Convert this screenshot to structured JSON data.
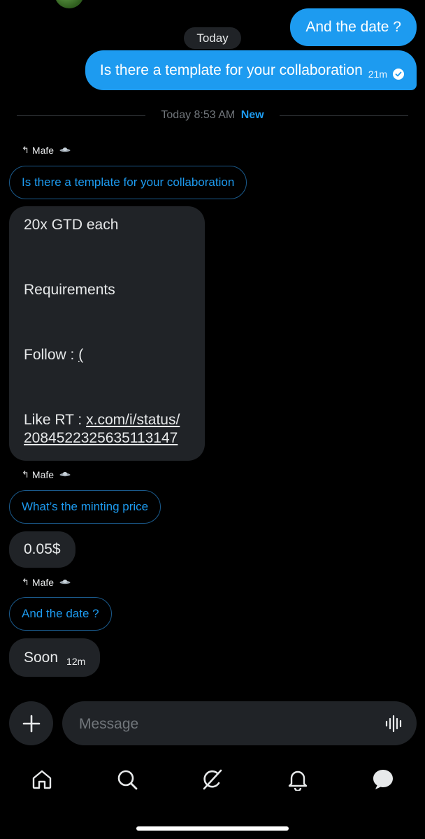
{
  "top_messages": {
    "out_1": "And the date ?",
    "date_pill": "Today",
    "out_2": "Is there a template for your collaboration",
    "out_2_time": "21m"
  },
  "divider": {
    "time": "Today 8:53 AM",
    "new_label": "New"
  },
  "thread": [
    {
      "reply_to": "Mafe",
      "quoted": "Is there a template for your collaboration"
    },
    {
      "reply_to": "Mafe",
      "quoted": "What’s the minting price",
      "answer": "0.05$"
    },
    {
      "reply_to": "Mafe",
      "quoted": "And the date ?",
      "answer": "Soon",
      "answer_time": "12m"
    }
  ],
  "big_message": {
    "line1": "20x GTD each",
    "line2": "Requirements",
    "line3": "Follow : ",
    "line3_link": "(",
    "line4_prefix": "Like RT : ",
    "line4_link_a": "x.com/i/status/",
    "line4_link_b": "2084522325635113147"
  },
  "composer": {
    "placeholder": "Message"
  },
  "nav": {
    "items": [
      "home-icon",
      "search-icon",
      "grok-icon",
      "notifications-icon",
      "messages-icon"
    ]
  },
  "colors": {
    "accent": "#1d9bf0",
    "bubble_in": "#202327",
    "background": "#000000"
  }
}
